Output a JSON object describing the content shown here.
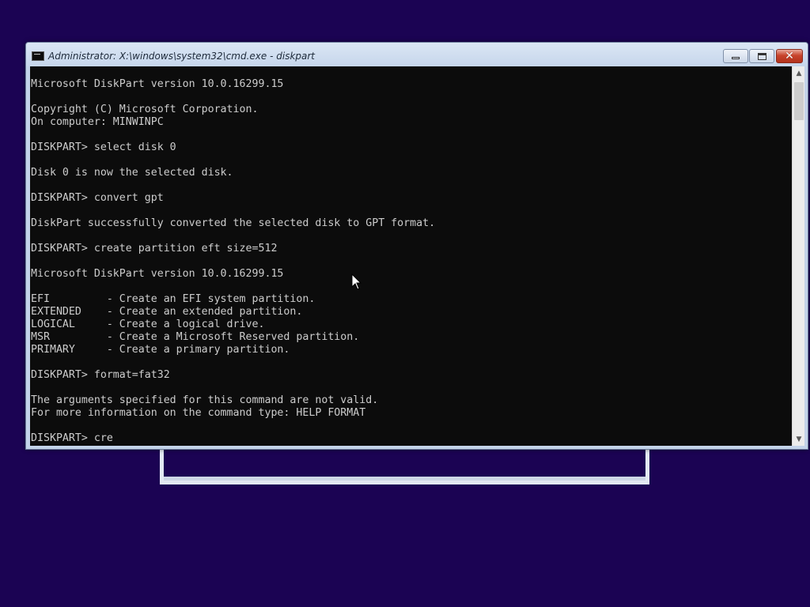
{
  "window": {
    "title": "Administrator: X:\\windows\\system32\\cmd.exe - diskpart",
    "close_glyph": "✕",
    "icons": {
      "app": "cmd-icon",
      "minimize": "minimize-icon",
      "maximize": "maximize-icon",
      "close": "close-icon"
    }
  },
  "console": {
    "lines": [
      "Microsoft DiskPart version 10.0.16299.15",
      "",
      "Copyright (C) Microsoft Corporation.",
      "On computer: MINWINPC",
      "",
      "DISKPART> select disk 0",
      "",
      "Disk 0 is now the selected disk.",
      "",
      "DISKPART> convert gpt",
      "",
      "DiskPart successfully converted the selected disk to GPT format.",
      "",
      "DISKPART> create partition eft size=512",
      "",
      "Microsoft DiskPart version 10.0.16299.15",
      "",
      "EFI         - Create an EFI system partition.",
      "EXTENDED    - Create an extended partition.",
      "LOGICAL     - Create a logical drive.",
      "MSR         - Create a Microsoft Reserved partition.",
      "PRIMARY     - Create a primary partition.",
      "",
      "DISKPART> format=fat32",
      "",
      "The arguments specified for this command are not valid.",
      "For more information on the command type: HELP FORMAT",
      "",
      "DISKPART> cre"
    ]
  },
  "scrollbar": {
    "up_arrow": "▲",
    "down_arrow": "▼",
    "up_icon": "scroll-up-icon",
    "down_icon": "scroll-down-icon"
  },
  "colors": {
    "desktop": "#1b0353",
    "console_bg": "#0c0c0c",
    "console_fg": "#cccccc",
    "frame": "#c3d3e9",
    "close_button": "#c8442c"
  }
}
